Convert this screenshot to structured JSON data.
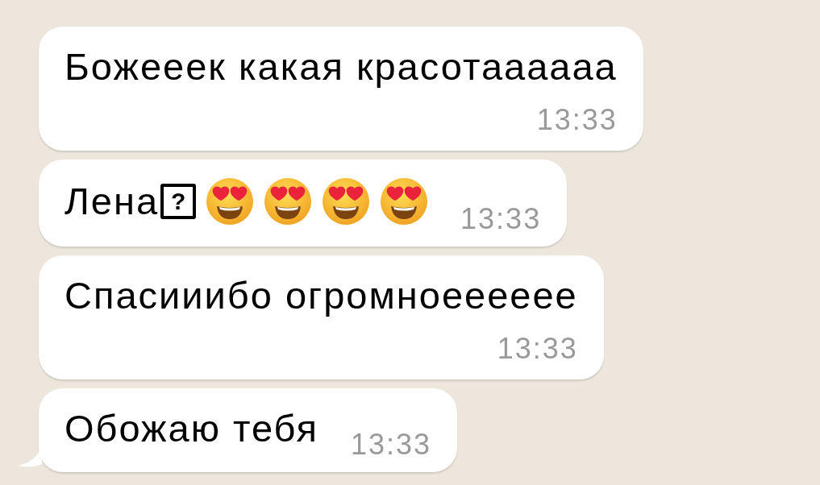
{
  "messages": [
    {
      "kind": "stacked",
      "text": "Божееек какая красотаааааа",
      "time": "13:33",
      "tail": false
    },
    {
      "kind": "inline",
      "text": "Лена",
      "unknown_char": "?",
      "emojis": [
        {
          "kind": "heart_eyes"
        },
        {
          "kind": "heart_eyes"
        },
        {
          "kind": "heart_eyes"
        },
        {
          "kind": "heart_eyes"
        }
      ],
      "time": "13:33",
      "tail": false
    },
    {
      "kind": "stacked",
      "text": "Спасииибо огромноееееее",
      "time": "13:33",
      "tail": false
    },
    {
      "kind": "inline",
      "text": "Обожаю тебя",
      "time": "13:33",
      "tail": true
    }
  ]
}
